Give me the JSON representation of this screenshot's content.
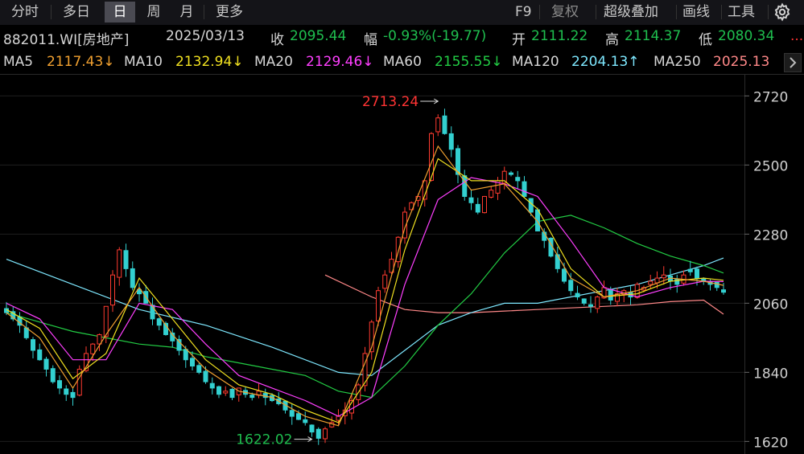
{
  "toolbar": {
    "tabs": [
      {
        "label": "分时",
        "active": false
      },
      {
        "label": "多日",
        "active": false
      },
      {
        "label": "日",
        "active": true
      },
      {
        "label": "周",
        "active": false
      },
      {
        "label": "月",
        "active": false
      },
      {
        "label": "更多",
        "active": false
      }
    ],
    "right": [
      "F9",
      "复权",
      "超级叠加",
      "画线",
      "工具"
    ],
    "settings_icon": "gear-icon"
  },
  "info": {
    "code": "882011.WI[房地产]",
    "date": "2025/03/13",
    "close_label": "收",
    "close": "2095.44",
    "change_label": "幅",
    "change": "-0.93%(-19.77)",
    "open_label": "开",
    "open": "2111.22",
    "high_label": "高",
    "high": "2114.37",
    "low_label": "低",
    "low": "2080.34",
    "more": "..."
  },
  "ma": {
    "ma5": {
      "label": "MA5",
      "value": "2117.43↓",
      "color": "#f0a030"
    },
    "ma10": {
      "label": "MA10",
      "value": "2132.94↓",
      "color": "#f0e020"
    },
    "ma20": {
      "label": "MA20",
      "value": "2129.46↓",
      "color": "#ff3fff"
    },
    "ma60": {
      "label": "MA60",
      "value": "2155.55↓",
      "color": "#22cc44"
    },
    "ma120": {
      "label": "MA120",
      "value": "2204.13↑",
      "color": "#7ee8ff"
    },
    "ma250": {
      "label": "MA250",
      "value": "2025.13",
      "color": "#ff8888"
    }
  },
  "chart_data": {
    "type": "line",
    "ylim": [
      1580,
      2790
    ],
    "y_ticks": [
      2720,
      2500,
      2280,
      2060,
      1840,
      1620
    ],
    "annotations": [
      {
        "text": "2713.24",
        "value": 2713.24,
        "index": 65,
        "color": "#ff3333"
      },
      {
        "text": "1622.02",
        "value": 1622.02,
        "index": 46,
        "color": "#1fbf4f"
      }
    ],
    "candle_colors": {
      "up": "#ff3b30",
      "down": "#33d0d0"
    },
    "close": [
      2030,
      2010,
      1990,
      1950,
      1910,
      1880,
      1850,
      1810,
      1790,
      1770,
      1760,
      1850,
      1900,
      1930,
      1960,
      2050,
      2150,
      2230,
      2170,
      2110,
      2090,
      2060,
      2010,
      1990,
      1960,
      1940,
      1910,
      1880,
      1860,
      1840,
      1810,
      1790,
      1770,
      1780,
      1760,
      1790,
      1770,
      1760,
      1780,
      1760,
      1750,
      1740,
      1720,
      1700,
      1690,
      1680,
      1650,
      1630,
      1660,
      1680,
      1700,
      1720,
      1750,
      1800,
      1900,
      2000,
      2100,
      2150,
      2200,
      2270,
      2350,
      2380,
      2400,
      2450,
      2600,
      2650,
      2600,
      2550,
      2470,
      2400,
      2380,
      2350,
      2400,
      2420,
      2450,
      2480,
      2470,
      2450,
      2400,
      2350,
      2290,
      2260,
      2210,
      2170,
      2130,
      2100,
      2080,
      2060,
      2050,
      2080,
      2110,
      2070,
      2090,
      2100,
      2080,
      2120,
      2110,
      2130,
      2140,
      2150,
      2130,
      2120,
      2150,
      2160,
      2140,
      2130,
      2120,
      2110,
      2095
    ],
    "ma": {
      "ma5": {
        "x": [
          0,
          5,
          10,
          15,
          20,
          25,
          30,
          35,
          40,
          45,
          50,
          55,
          60,
          65,
          70,
          75,
          80,
          85,
          90,
          95,
          100,
          105,
          108
        ],
        "y": [
          2030,
          1950,
          1790,
          1960,
          2110,
          1960,
          1850,
          1780,
          1760,
          1700,
          1670,
          1920,
          2300,
          2560,
          2420,
          2440,
          2320,
          2140,
          2080,
          2100,
          2140,
          2130,
          2117
        ]
      },
      "ma10": {
        "x": [
          0,
          5,
          10,
          15,
          20,
          25,
          30,
          35,
          40,
          45,
          50,
          55,
          60,
          65,
          70,
          75,
          80,
          85,
          90,
          95,
          100,
          105,
          108
        ],
        "y": [
          2040,
          1980,
          1820,
          1900,
          2140,
          2010,
          1880,
          1800,
          1770,
          1720,
          1680,
          1840,
          2230,
          2520,
          2450,
          2450,
          2360,
          2170,
          2080,
          2090,
          2130,
          2140,
          2133
        ]
      },
      "ma20": {
        "x": [
          0,
          5,
          10,
          15,
          20,
          25,
          30,
          35,
          40,
          45,
          50,
          55,
          60,
          65,
          70,
          75,
          80,
          85,
          90,
          95,
          100,
          105,
          108
        ],
        "y": [
          2060,
          2010,
          1880,
          1880,
          2060,
          2040,
          1930,
          1830,
          1790,
          1750,
          1700,
          1760,
          2120,
          2390,
          2460,
          2440,
          2400,
          2260,
          2110,
          2080,
          2110,
          2130,
          2129
        ]
      },
      "ma60": {
        "x": [
          0,
          5,
          10,
          15,
          20,
          25,
          30,
          35,
          40,
          45,
          50,
          55,
          60,
          65,
          70,
          75,
          80,
          85,
          90,
          95,
          100,
          105,
          108
        ],
        "y": [
          2030,
          2000,
          1970,
          1950,
          1930,
          1920,
          1890,
          1870,
          1850,
          1830,
          1780,
          1760,
          1860,
          1990,
          2090,
          2220,
          2320,
          2340,
          2300,
          2250,
          2210,
          2180,
          2156
        ]
      },
      "ma120": {
        "x": [
          0,
          10,
          20,
          30,
          40,
          50,
          55,
          60,
          65,
          70,
          75,
          80,
          85,
          90,
          95,
          100,
          105,
          108
        ],
        "y": [
          2200,
          2120,
          2040,
          1990,
          1920,
          1840,
          1830,
          1910,
          1990,
          2030,
          2060,
          2060,
          2080,
          2100,
          2120,
          2150,
          2180,
          2204
        ]
      },
      "ma250": {
        "x": [
          48,
          55,
          60,
          65,
          70,
          75,
          80,
          85,
          90,
          95,
          100,
          105,
          108
        ],
        "y": [
          2150,
          2080,
          2040,
          2030,
          2030,
          2035,
          2040,
          2045,
          2050,
          2055,
          2065,
          2070,
          2025
        ]
      }
    }
  }
}
